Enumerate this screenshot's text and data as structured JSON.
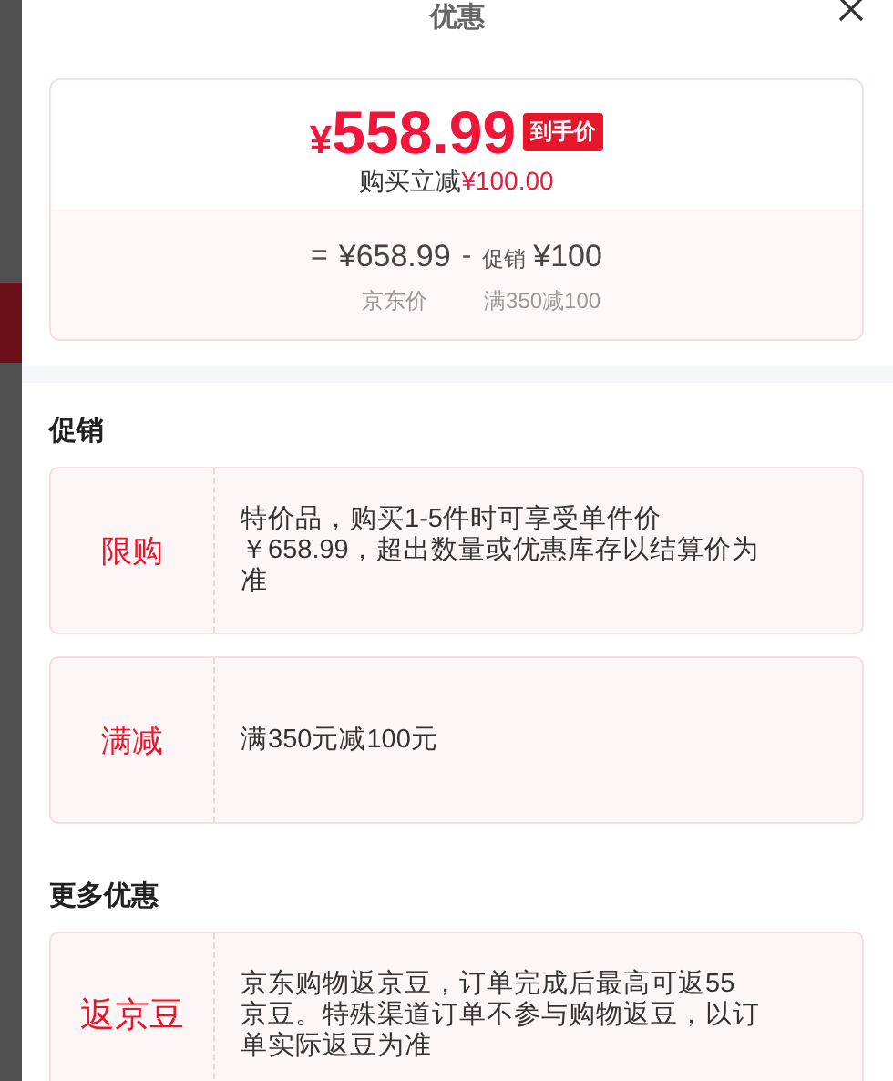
{
  "dialog": {
    "title": "优惠"
  },
  "price_card": {
    "currency": "¥",
    "final_price": "558.99",
    "price_badge": "到手价",
    "savings_label": "购买立减",
    "savings_amount": "¥100.00",
    "terms": [
      {
        "operator": "=",
        "amount": "¥658.99",
        "caption": "京东价"
      },
      {
        "operator": "-",
        "tag": "促销",
        "amount": "¥100",
        "caption": "满350减100"
      }
    ]
  },
  "sections": [
    {
      "title": "促销",
      "offers": [
        {
          "tag": "限购",
          "text": "特价品，购买1-5件时可享受单件价￥658.99，超出数量或优惠库存以结算价为准"
        },
        {
          "tag": "满减",
          "text": "满350元减100元"
        }
      ]
    },
    {
      "title": "更多优惠",
      "offers": [
        {
          "tag": "返京豆",
          "text": "京东购物返京豆，订单完成后最高可返55京豆。特殊渠道订单不参与购物返豆，以订单实际返豆为准"
        }
      ]
    }
  ]
}
